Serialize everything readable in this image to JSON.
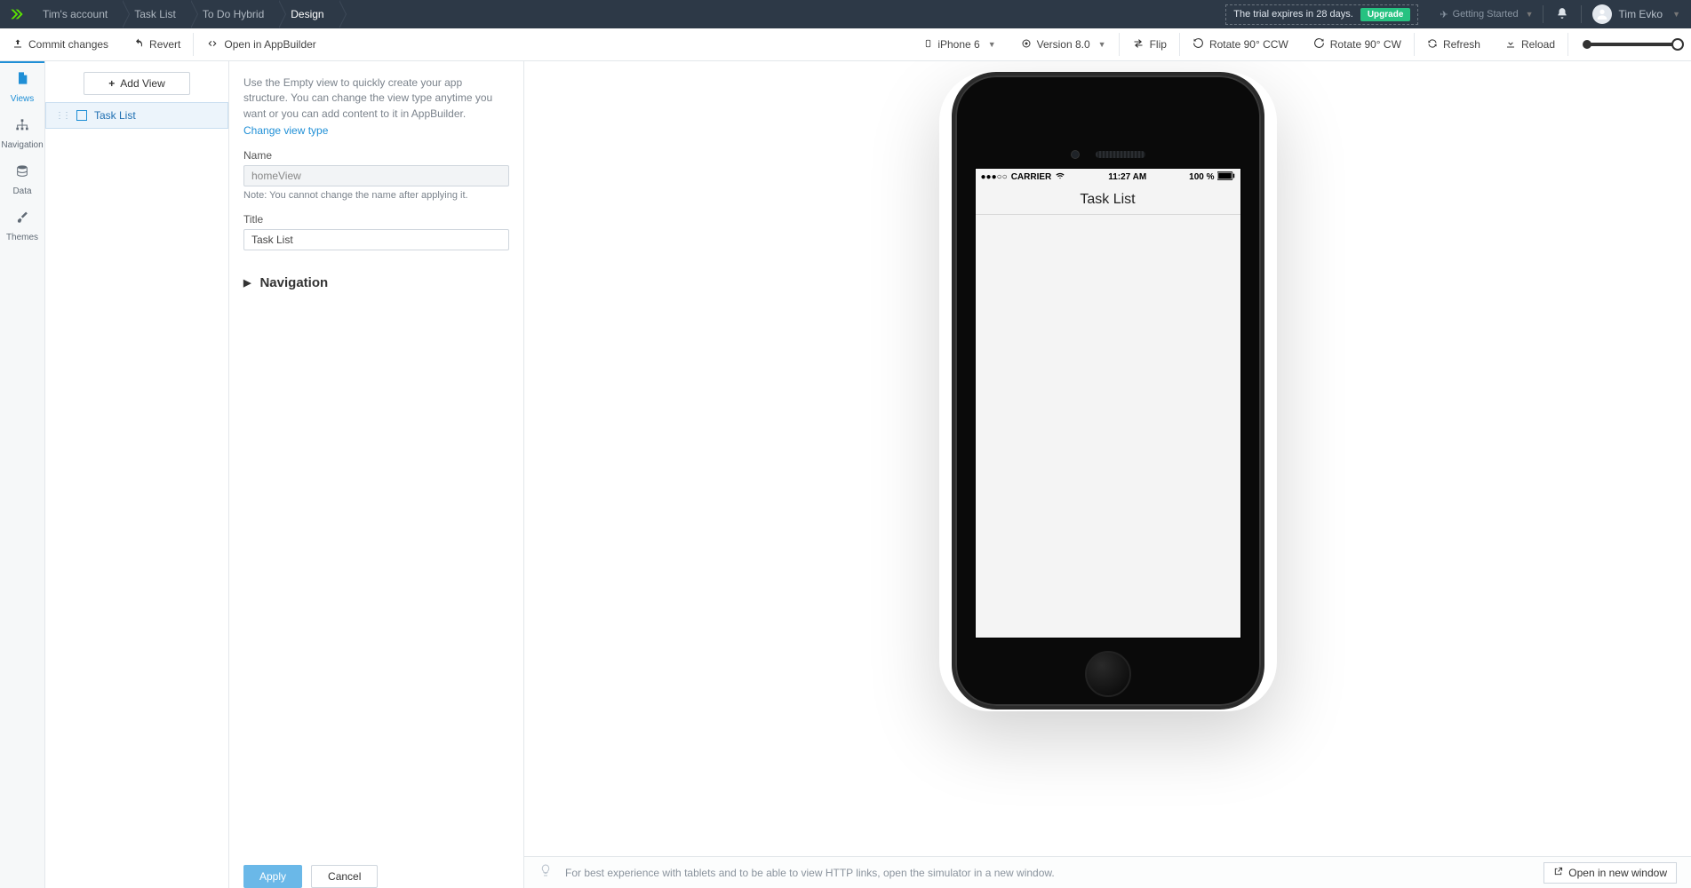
{
  "header": {
    "crumbs": [
      "Tim's account",
      "Task List",
      "To Do Hybrid",
      "Design"
    ],
    "trial_text": "The trial expires in 28 days.",
    "upgrade": "Upgrade",
    "getting_started": "Getting Started",
    "user_name": "Tim Evko"
  },
  "toolbar": {
    "commit": "Commit changes",
    "revert": "Revert",
    "open_appbuilder": "Open in AppBuilder",
    "device": "iPhone 6",
    "version": "Version 8.0",
    "flip": "Flip",
    "rotate_ccw": "Rotate 90° CCW",
    "rotate_cw": "Rotate 90° CW",
    "refresh": "Refresh",
    "reload": "Reload"
  },
  "rail": {
    "views": "Views",
    "navigation": "Navigation",
    "data": "Data",
    "themes": "Themes"
  },
  "views_panel": {
    "add_view": "Add View",
    "items": [
      {
        "label": "Task List"
      }
    ]
  },
  "props": {
    "desc": "Use the Empty view to quickly create your app structure. You can change the view type anytime you want or you can add content to it in AppBuilder.",
    "change_type": "Change view type",
    "name_label": "Name",
    "name_value": "homeView",
    "name_note": "Note: You cannot change the name after applying it.",
    "title_label": "Title",
    "title_value": "Task List",
    "nav_section": "Navigation",
    "apply": "Apply",
    "cancel": "Cancel"
  },
  "phone": {
    "carrier": "CARRIER",
    "time": "11:27 AM",
    "battery": "100 %",
    "app_title": "Task List"
  },
  "footer": {
    "tip": "For best experience with tablets and to be able to view HTTP links, open the simulator in a new window.",
    "open_new": "Open in new window"
  }
}
